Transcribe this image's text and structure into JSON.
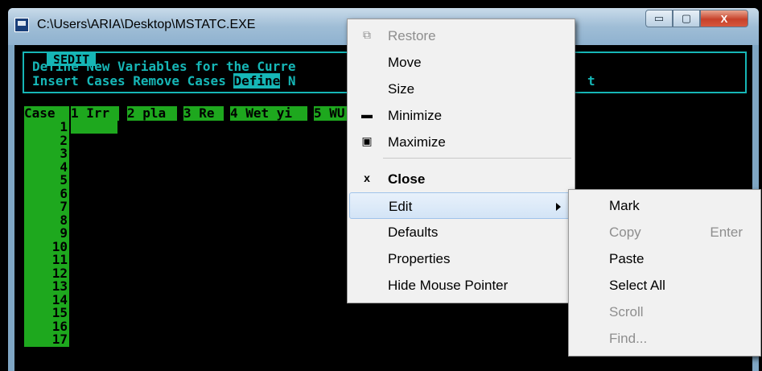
{
  "window": {
    "title": "C:\\Users\\ARIA\\Desktop\\MSTATC.EXE",
    "icon": "msdos-app-icon",
    "controls": {
      "minimize": "▭",
      "maximize": "▢",
      "close": "X"
    }
  },
  "console": {
    "sedit_title": "SEDIT",
    "line1": "Define New Variables for the Curre",
    "line2_a": "Insert Cases Remove Cases ",
    "line2_highlight": "Define",
    "line2_b": " N",
    "line2_tail": "t",
    "grid_header": [
      "Case",
      "1 Irr",
      "2 pla",
      "3 Re",
      "4 Wet yi",
      "5 WU"
    ],
    "row_numbers": [
      "1",
      "2",
      "3",
      "4",
      "5",
      "6",
      "7",
      "8",
      "9",
      "10",
      "11",
      "12",
      "13",
      "14",
      "15",
      "16",
      "17"
    ]
  },
  "system_menu": {
    "items": [
      {
        "label": "Restore",
        "icon": "restore-icon",
        "glyph": "⧉",
        "disabled": true
      },
      {
        "label": "Move",
        "icon": "",
        "glyph": "",
        "disabled": false
      },
      {
        "label": "Size",
        "icon": "",
        "glyph": "",
        "disabled": false
      },
      {
        "label": "Minimize",
        "icon": "minimize-icon",
        "glyph": "▬",
        "disabled": false
      },
      {
        "label": "Maximize",
        "icon": "maximize-icon",
        "glyph": "▣",
        "disabled": false
      },
      {
        "label": "Close",
        "icon": "close-icon",
        "glyph": "x",
        "disabled": false,
        "bold": true
      },
      {
        "label": "Edit",
        "icon": "",
        "glyph": "",
        "disabled": false,
        "submenu": true,
        "highlighted": true
      },
      {
        "label": "Defaults",
        "icon": "",
        "glyph": "",
        "disabled": false
      },
      {
        "label": "Properties",
        "icon": "",
        "glyph": "",
        "disabled": false
      },
      {
        "label": "Hide Mouse Pointer",
        "icon": "",
        "glyph": "",
        "disabled": false
      }
    ]
  },
  "edit_submenu": {
    "items": [
      {
        "label": "Mark",
        "disabled": false,
        "shortcut": ""
      },
      {
        "label": "Copy",
        "disabled": true,
        "shortcut": "Enter"
      },
      {
        "label": "Paste",
        "disabled": false,
        "shortcut": ""
      },
      {
        "label": "Select All",
        "disabled": false,
        "shortcut": ""
      },
      {
        "label": "Scroll",
        "disabled": false,
        "shortcut": ""
      },
      {
        "label": "Find...",
        "disabled": true,
        "shortcut": ""
      }
    ]
  },
  "colors": {
    "console_cyan": "#16b6b6",
    "console_green": "#1ea81e",
    "menu_bg": "#f1f1f1",
    "highlight": "#d3e4f6"
  }
}
